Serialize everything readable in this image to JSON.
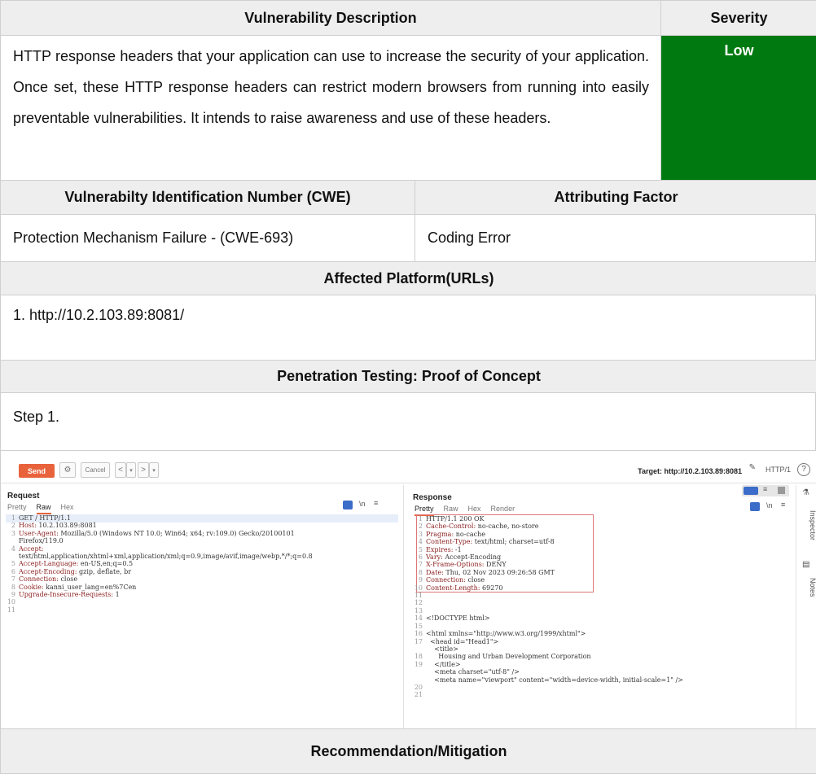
{
  "table": {
    "vuln_desc_header": "Vulnerability Description",
    "severity_header": "Severity",
    "description": "HTTP response headers that your application can use to increase the security of your application. Once set, these HTTP response headers can restrict modern browsers from running into easily preventable vulnerabilities. It intends to raise awareness and use of these headers.",
    "severity_value": "Low",
    "severity_color": "#007a10",
    "cwe_header": "Vulnerabilty Identification Number (CWE)",
    "factor_header": "Attributing Factor",
    "cwe_value": "Protection Mechanism Failure - (CWE-693)",
    "factor_value": "Coding Error",
    "platform_header": "Affected Platform(URLs)",
    "platform_value": "1. http://10.2.103.89:8081/",
    "poc_header": "Penetration Testing: Proof of Concept",
    "step": "Step 1.",
    "recommendation_header": "Recommendation/Mitigation"
  },
  "burp": {
    "send": "Send",
    "cancel": "Cancel",
    "target": "Target: http://10.2.103.89:8081",
    "protocol": "HTTP/1",
    "request_title": "Request",
    "response_title": "Response",
    "request_tabs": [
      "Pretty",
      "Raw",
      "Hex"
    ],
    "response_tabs": [
      "Pretty",
      "Raw",
      "Hex",
      "Render"
    ],
    "inspector": "Inspector",
    "notes": "Notes",
    "request_lines": [
      "GET / HTTP/1.1",
      "Host: 10.2.103.89:8081",
      "User-Agent: Mozilla/5.0 (Windows NT 10.0; Win64; x64; rv:109.0) Gecko/20100101",
      "Firefox/119.0",
      "Accept:",
      "text/html,application/xhtml+xml,application/xml;q=0.9,image/avif,image/webp,*/*;q=0.8",
      "Accept-Language: en-US,en;q=0.5",
      "Accept-Encoding: gzip, deflate, br",
      "Connection: close",
      "Cookie: kanni_user_lang=en%7Cen",
      "Upgrade-Insecure-Requests: 1",
      "",
      ""
    ],
    "request_line_numbers": [
      "1",
      "2",
      "3",
      "",
      "4",
      "",
      "5",
      "6",
      "7",
      "8",
      "9",
      "10",
      "11"
    ],
    "response_lines": [
      "HTTP/1.1 200 OK",
      "Cache-Control: no-cache, no-store",
      "Pragma: no-cache",
      "Content-Type: text/html; charset=utf-8",
      "Expires: -1",
      "Vary: Accept-Encoding",
      "X-Frame-Options: DENY",
      "Date: Thu, 02 Nov 2023 09:26:58 GMT",
      "Connection: close",
      "Content-Length: 69270",
      "",
      "",
      "",
      "<!DOCTYPE html>",
      "",
      "<html xmlns=\"http://www.w3.org/1999/xhtml\">",
      "  <head id=\"Head1\">",
      "    <title>",
      "      Housing and Urban Development Corporation",
      "    </title>",
      "    <meta charset=\"utf-8\" />",
      "    <meta name=\"viewport\" content=\"width=device-width, initial-scale=1\" />",
      "",
      ""
    ],
    "response_line_numbers": [
      "1",
      "2",
      "3",
      "4",
      "5",
      "6",
      "7",
      "8",
      "9",
      "10",
      "11",
      "12",
      "13",
      "14",
      "15",
      "16",
      "17",
      "",
      "18",
      "19",
      "",
      "",
      "20",
      "21"
    ]
  }
}
